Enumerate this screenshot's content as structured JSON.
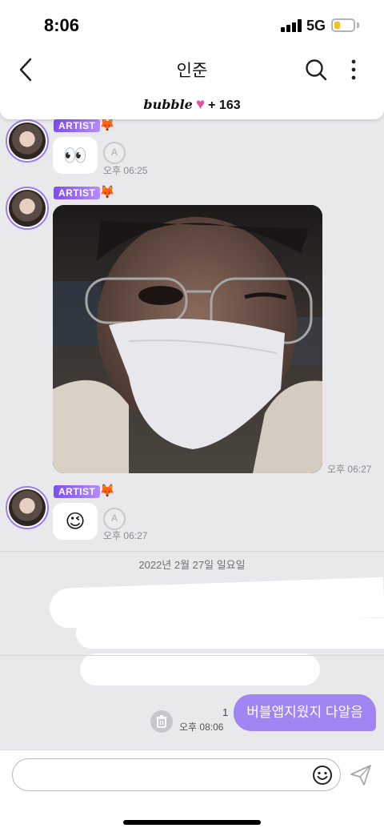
{
  "status_bar": {
    "time": "8:06",
    "network": "5G",
    "battery_level": 0.3
  },
  "header": {
    "title": "인준",
    "back_icon": "chevron-left-icon",
    "search_icon": "search-icon",
    "more_icon": "more-vertical-icon"
  },
  "bubble_bar": {
    "brand": "bubble",
    "plus": "+ 163"
  },
  "messages": [
    {
      "badge": "ARTIST",
      "content": "👀",
      "time": "오후 06:25"
    },
    {
      "badge": "ARTIST",
      "content": "photo",
      "time": "오후 06:27"
    },
    {
      "badge": "ARTIST",
      "content": "😉",
      "time": "오후 06:27"
    }
  ],
  "date_divider": "2022년 2월 27일 일요일",
  "my_message": {
    "text": "버블앱지웠지 다알음",
    "time": "오후 08:06",
    "read_count": "1"
  },
  "input": {
    "value": "",
    "placeholder": ""
  },
  "colors": {
    "accent": "#9f86f2",
    "artist_badge": "#7d4cf3",
    "heart": "#e0559e"
  }
}
